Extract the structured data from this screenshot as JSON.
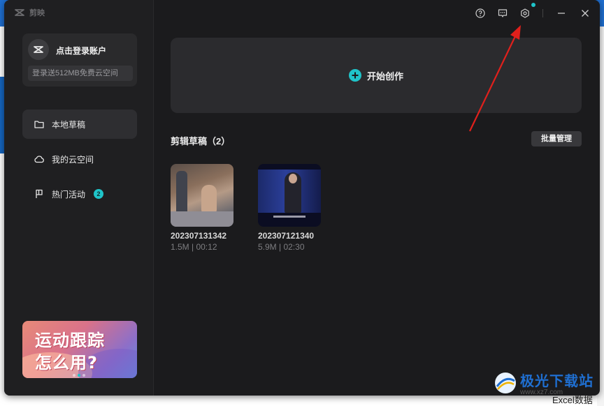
{
  "app": {
    "logo_text": "剪映"
  },
  "sidebar": {
    "login": {
      "label": "点击登录账户",
      "promo": "登录送512MB免费云空间"
    },
    "items": [
      {
        "label": "本地草稿",
        "icon": "folder-icon",
        "active": true
      },
      {
        "label": "我的云空间",
        "icon": "cloud-icon",
        "active": false
      },
      {
        "label": "热门活动",
        "icon": "flag-icon",
        "active": false,
        "badge": "2"
      }
    ],
    "banner": {
      "line1": "运动跟踪",
      "line2": "怎么用?"
    }
  },
  "toolbar": {
    "icons": [
      "help-icon",
      "feedback-icon",
      "settings-icon",
      "minimize-icon",
      "close-icon"
    ],
    "settings_has_notification": true
  },
  "main": {
    "create_label": "开始创作",
    "section_title": "剪辑草稿（2）",
    "batch_label": "批量管理",
    "drafts": [
      {
        "name": "202307131342",
        "meta": "1.5M | 00:12"
      },
      {
        "name": "202307121340",
        "meta": "5.9M | 02:30"
      }
    ]
  },
  "background": {
    "bottom_text": "Excel数据"
  },
  "watermark": {
    "title": "极光下载站",
    "url": "www.xz7.com"
  },
  "colors": {
    "accent": "#1fc4c9",
    "window_bg": "#1b1b1d",
    "sidebar_bg": "#1f1f21",
    "annotation_arrow": "#e0201c"
  }
}
